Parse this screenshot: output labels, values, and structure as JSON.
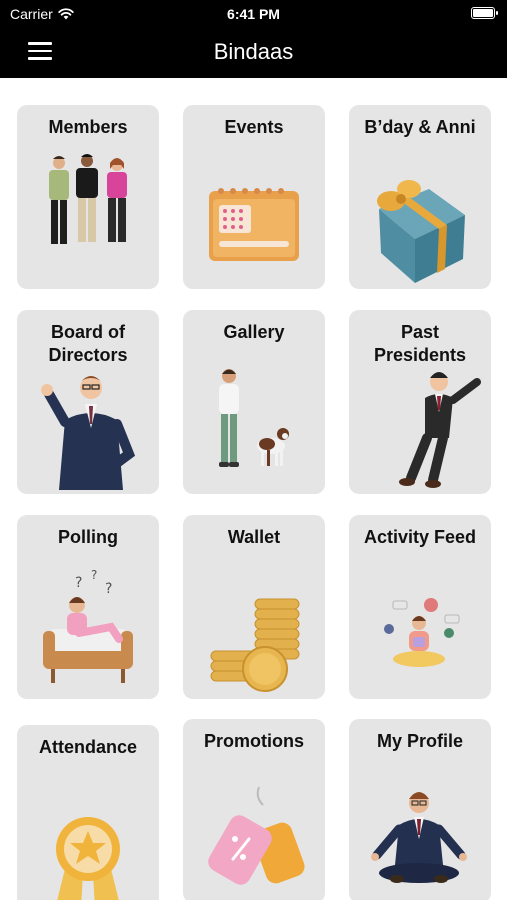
{
  "status_bar": {
    "carrier": "Carrier",
    "time": "6:41 PM",
    "wifi_icon": "wifi-icon",
    "battery_icon": "battery-icon"
  },
  "nav": {
    "title": "Bindaas",
    "menu_icon": "hamburger-menu-icon"
  },
  "tiles": [
    {
      "label": "Members",
      "icon": "members-illustration"
    },
    {
      "label": "Events",
      "icon": "calendar-illustration"
    },
    {
      "label": "B’day & Anni",
      "icon": "gift-box-illustration"
    },
    {
      "label": "Board of\nDirectors",
      "icon": "waving-businessman-illustration"
    },
    {
      "label": "Gallery",
      "icon": "man-with-dog-illustration"
    },
    {
      "label": "Past\nPresidents",
      "icon": "leaning-businessman-illustration"
    },
    {
      "label": "Polling",
      "icon": "thinking-woman-on-sofa-illustration"
    },
    {
      "label": "Wallet",
      "icon": "coin-stacks-illustration"
    },
    {
      "label": "Activity Feed",
      "icon": "meditating-woman-social-illustration"
    },
    {
      "label": "Attendance",
      "icon": "star-medal-illustration"
    },
    {
      "label": "Promotions",
      "icon": "price-tags-illustration"
    },
    {
      "label": "My Profile",
      "icon": "meditating-businessman-illustration"
    }
  ]
}
